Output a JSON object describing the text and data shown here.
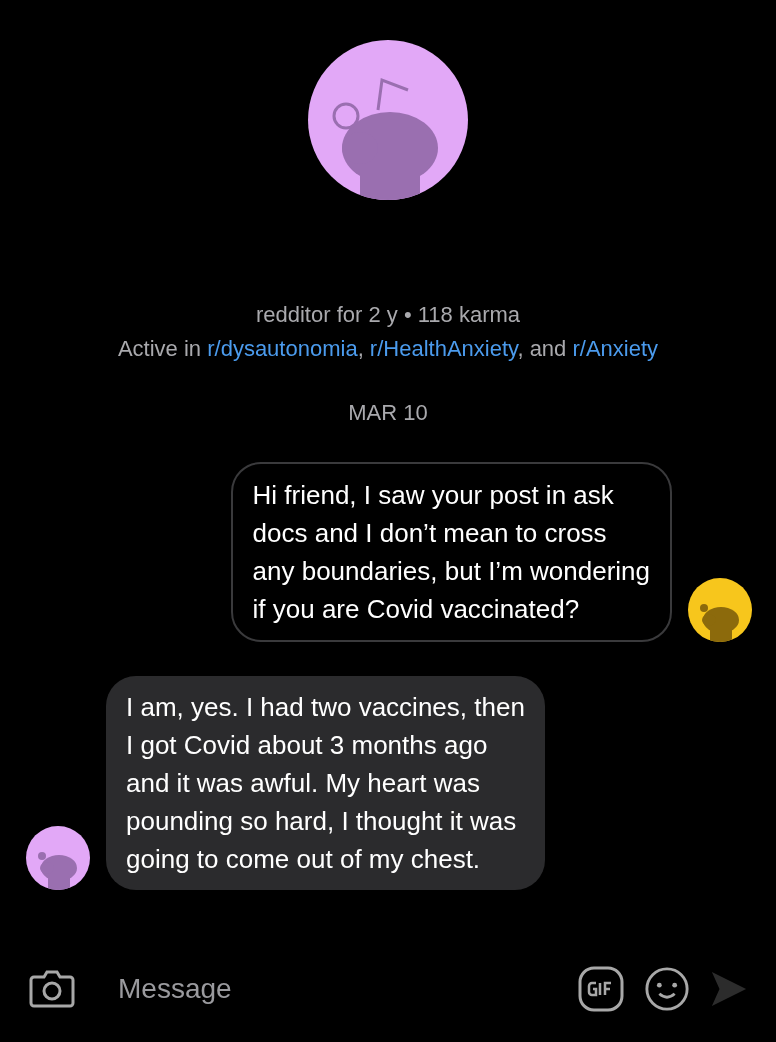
{
  "profile": {
    "color": "#e2a8f7",
    "meta": "redditor for 2 y • 118 karma",
    "active_in": [
      {
        "kind": "plain",
        "text": "Active in "
      },
      {
        "kind": "link",
        "text": "r/dysautonomia"
      },
      {
        "kind": "plain",
        "text": ", "
      },
      {
        "kind": "link",
        "text": "r/HealthAnxiety"
      },
      {
        "kind": "plain",
        "text": ", and "
      },
      {
        "kind": "link",
        "text": "r/Anxiety"
      }
    ]
  },
  "date": "MAR 10",
  "messages": [
    {
      "kind": "outgoing",
      "color": "#f7c61c",
      "text": "Hi friend, I saw your post in ask\ndocs and I don’t mean to cross\nany boundaries, but I’m wondering\nif you are Covid vaccinated?"
    },
    {
      "kind": "incoming",
      "color": "#e2a8f7",
      "text": "I am, yes. I had two vaccines, then\nI got Covid about 3 months ago\nand it was awful. My heart was\npounding so hard, I thought it was\ngoing to come out of my chest."
    }
  ],
  "composer": {
    "placeholder": "Message"
  }
}
